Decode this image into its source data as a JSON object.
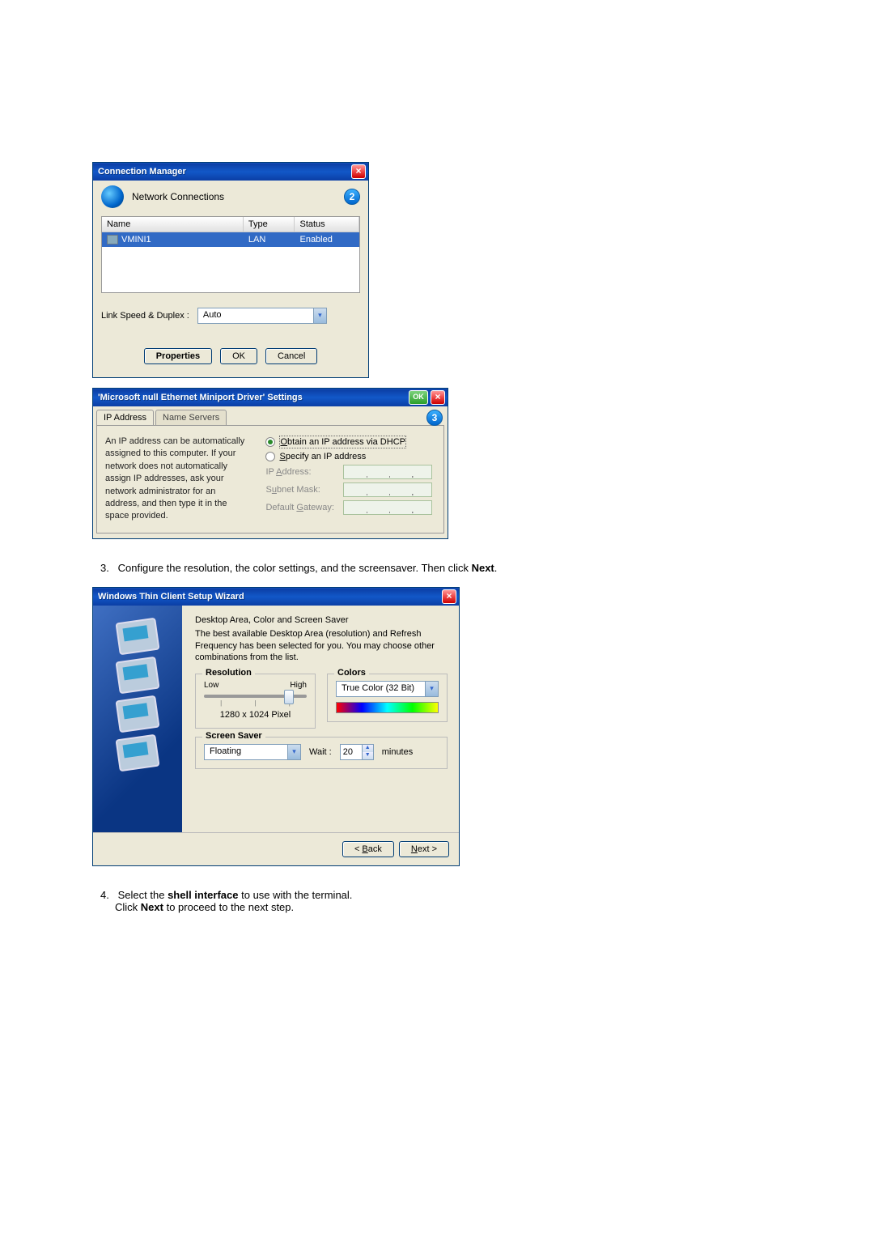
{
  "connection_manager": {
    "title": "Connection Manager",
    "header_label": "Network Connections",
    "badge": "2",
    "columns": {
      "name": "Name",
      "type": "Type",
      "status": "Status"
    },
    "row": {
      "name": "VMINI1",
      "type": "LAN",
      "status": "Enabled"
    },
    "link_speed_label": "Link Speed & Duplex :",
    "link_speed_value": "Auto",
    "buttons": {
      "properties": "Properties",
      "ok": "OK",
      "cancel": "Cancel"
    }
  },
  "driver_settings": {
    "title": "'Microsoft null Ethernet Miniport Driver' Settings",
    "ok": "OK",
    "badge": "3",
    "tabs": {
      "ip": "IP Address",
      "ns": "Name Servers"
    },
    "help_text": "An IP address can be automatically assigned to this computer.  If your network does not automatically assign IP addresses, ask your network administrator for an address, and then type it in the space provided.",
    "radios": {
      "dhcp": "Obtain an IP address via DHCP",
      "specify": "Specify an IP address"
    },
    "fields": {
      "ip": "IP Address:",
      "subnet": "Subnet Mask:",
      "gateway": "Default Gateway:"
    }
  },
  "step3": {
    "prefix": "3.",
    "text_a": "Configure the resolution, the color settings, and the screensaver. Then click ",
    "next": "Next",
    "period": "."
  },
  "wizard": {
    "title": "Windows Thin Client Setup Wizard",
    "heading": "Desktop Area, Color and Screen Saver",
    "desc": "The best available Desktop Area (resolution) and Refresh Frequency has been selected for you.  You may choose other combinations from the list.",
    "resolution": {
      "legend": "Resolution",
      "low": "Low",
      "high": "High",
      "value": "1280 x 1024 Pixel"
    },
    "colors": {
      "legend": "Colors",
      "value": "True Color (32 Bit)"
    },
    "screensaver": {
      "legend": "Screen Saver",
      "value": "Floating",
      "wait_label": "Wait :",
      "wait_value": "20",
      "unit": "minutes"
    },
    "footer": {
      "back": "< Back",
      "next": "Next >"
    }
  },
  "step4": {
    "prefix": "4.",
    "line1_a": "Select the ",
    "line1_b": "shell interface",
    "line1_c": " to use with the terminal.",
    "line2_a": "Click ",
    "line2_b": "Next",
    "line2_c": " to proceed to the next step."
  }
}
